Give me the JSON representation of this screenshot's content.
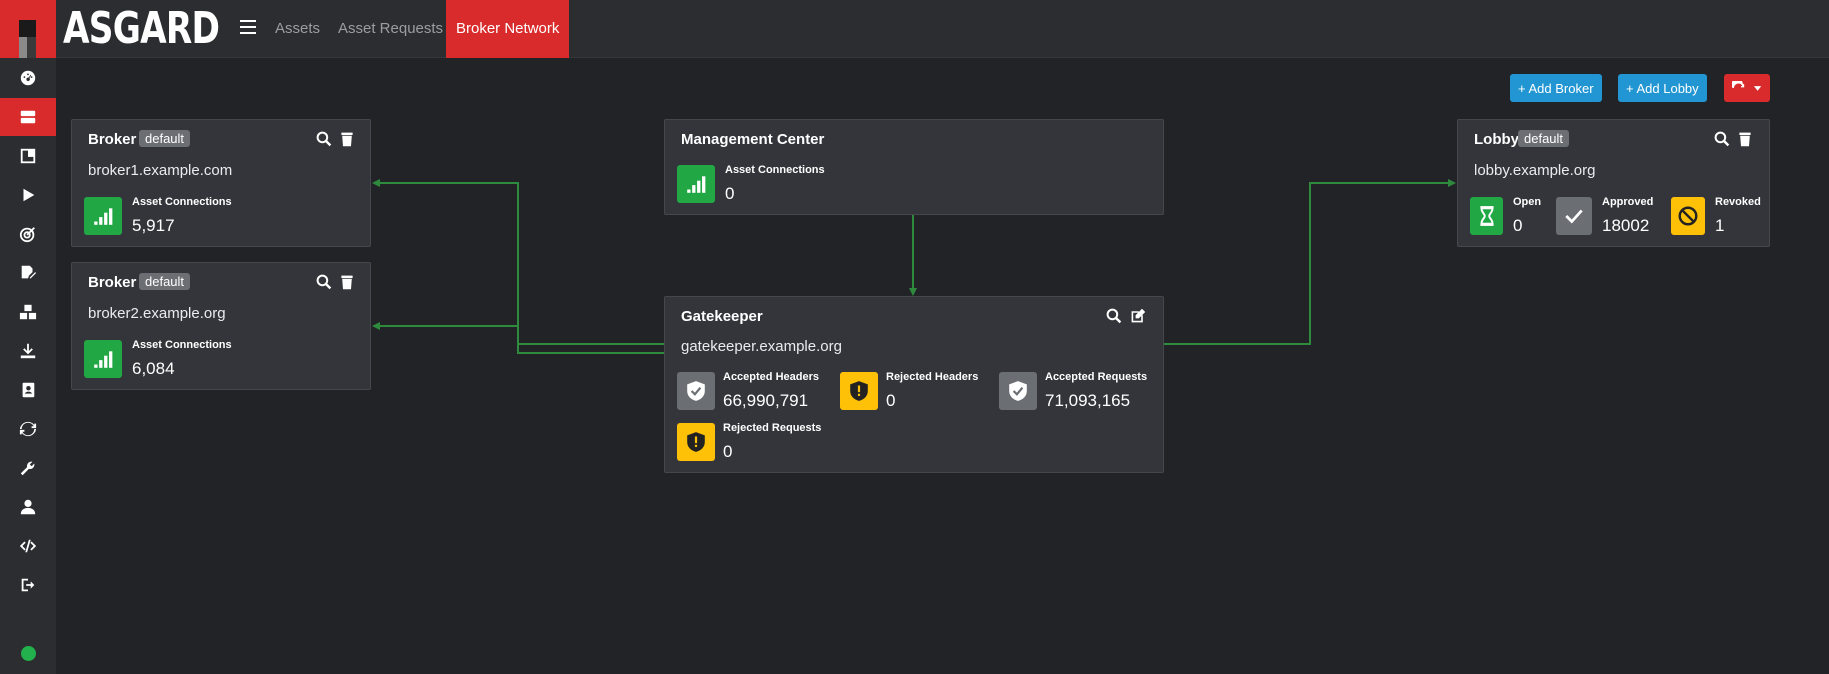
{
  "app": {
    "brand": "ASGARD"
  },
  "nav": {
    "assets": "Assets",
    "asset_requests": "Asset Requests",
    "broker_network": "Broker Network"
  },
  "toolbar": {
    "add_broker": "+ Add Broker",
    "add_lobby": "+ Add Lobby"
  },
  "brokers": [
    {
      "title": "Broker",
      "badge": "default",
      "host": "broker1.example.com",
      "conn_label": "Asset Connections",
      "conn_value": "5,917"
    },
    {
      "title": "Broker",
      "badge": "default",
      "host": "broker2.example.org",
      "conn_label": "Asset Connections",
      "conn_value": "6,084"
    }
  ],
  "management": {
    "title": "Management Center",
    "conn_label": "Asset Connections",
    "conn_value": "0"
  },
  "gatekeeper": {
    "title": "Gatekeeper",
    "host": "gatekeeper.example.org",
    "accepted_headers_label": "Accepted Headers",
    "accepted_headers_value": "66,990,791",
    "rejected_headers_label": "Rejected Headers",
    "rejected_headers_value": "0",
    "accepted_requests_label": "Accepted Requests",
    "accepted_requests_value": "71,093,165",
    "rejected_requests_label": "Rejected Requests",
    "rejected_requests_value": "0"
  },
  "lobby": {
    "title": "Lobby",
    "badge": "default",
    "host": "lobby.example.org",
    "open_label": "Open",
    "open_value": "0",
    "approved_label": "Approved",
    "approved_value": "18002",
    "revoked_label": "Revoked",
    "revoked_value": "1"
  },
  "colors": {
    "accent": "#d92b2b",
    "primary": "#2196d3",
    "success": "#22a745",
    "warning": "#ffc107",
    "wire": "#2e8b3e"
  }
}
